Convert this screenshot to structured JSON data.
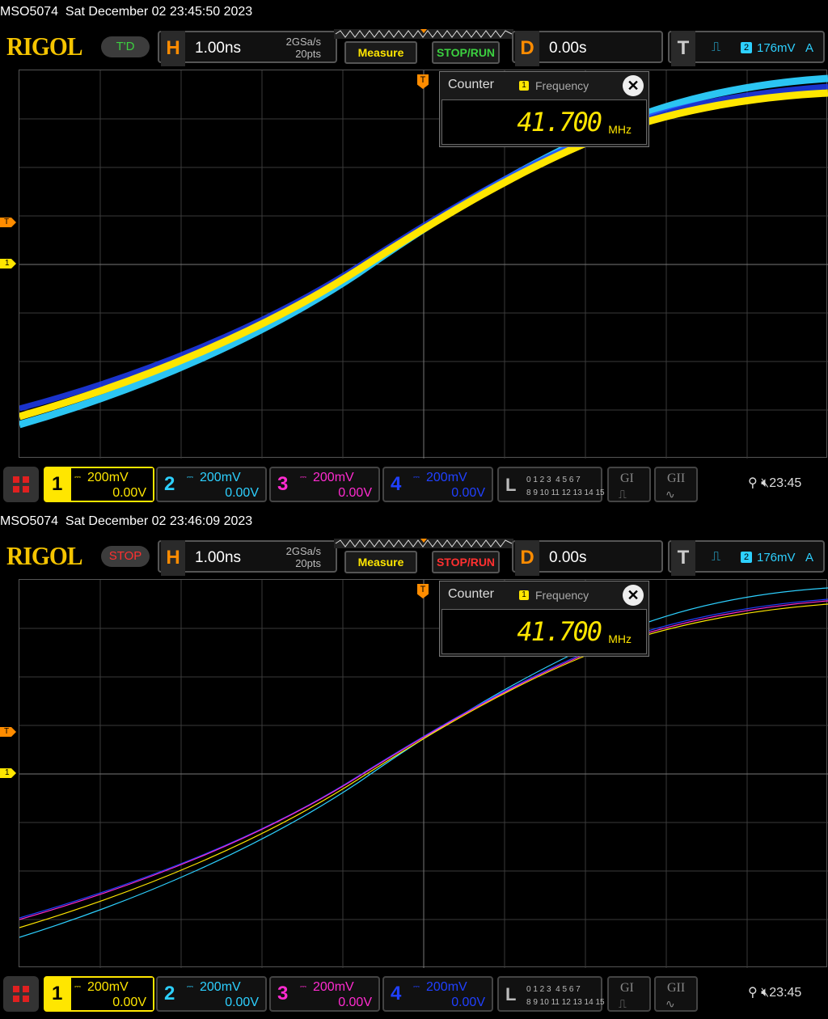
{
  "screens": [
    {
      "caption": "MSO5074  Sat December 02 23:45:50 2023",
      "logo": "RIGOL",
      "status": "T'D",
      "status_color": "#3cd040",
      "horizontal": {
        "letter": "H",
        "timebase": "1.00ns",
        "sample_rate": "2GSa/s",
        "points": "20pts"
      },
      "measure_label": "Measure",
      "stoprun_label": "STOP/RUN",
      "stoprun_color": "#3cd040",
      "delay": {
        "letter": "D",
        "value": "0.00s"
      },
      "trigger": {
        "letter": "T",
        "edge_icon": "rising-edge-icon",
        "source": "2",
        "level": "176mV",
        "mode": "A"
      },
      "markers": {
        "trigger_level": "T",
        "channel_1": "1"
      },
      "counter": {
        "title": "Counter",
        "channel": "1",
        "measurement": "Frequency",
        "value": "41.700",
        "unit": "MHz",
        "close": "✕"
      },
      "channels": [
        {
          "num": "1",
          "scale": "200mV",
          "offset": "0.00V"
        },
        {
          "num": "2",
          "scale": "200mV",
          "offset": "0.00V"
        },
        {
          "num": "3",
          "scale": "200mV",
          "offset": "0.00V"
        },
        {
          "num": "4",
          "scale": "200mV",
          "offset": "0.00V"
        }
      ],
      "logic": {
        "letter": "L",
        "row1": "0 1 2 3  4 5 6 7",
        "row2": "8 9 10 11 12 13 14 15"
      },
      "generators": [
        "GI",
        "GII"
      ],
      "clock": "23:45"
    },
    {
      "caption": "MSO5074  Sat December 02 23:46:09 2023",
      "logo": "RIGOL",
      "status": "STOP",
      "status_color": "#ff3030",
      "horizontal": {
        "letter": "H",
        "timebase": "1.00ns",
        "sample_rate": "2GSa/s",
        "points": "20pts"
      },
      "measure_label": "Measure",
      "stoprun_label": "STOP/RUN",
      "stoprun_color": "#ff3030",
      "delay": {
        "letter": "D",
        "value": "0.00s"
      },
      "trigger": {
        "letter": "T",
        "edge_icon": "rising-edge-icon",
        "source": "2",
        "level": "176mV",
        "mode": "A"
      },
      "markers": {
        "trigger_level": "T",
        "channel_1": "1"
      },
      "counter": {
        "title": "Counter",
        "channel": "1",
        "measurement": "Frequency",
        "value": "41.700",
        "unit": "MHz",
        "close": "✕"
      },
      "channels": [
        {
          "num": "1",
          "scale": "200mV",
          "offset": "0.00V"
        },
        {
          "num": "2",
          "scale": "200mV",
          "offset": "0.00V"
        },
        {
          "num": "3",
          "scale": "200mV",
          "offset": "0.00V"
        },
        {
          "num": "4",
          "scale": "200mV",
          "offset": "0.00V"
        }
      ],
      "logic": {
        "letter": "L",
        "row1": "0 1 2 3  4 5 6 7",
        "row2": "8 9 10 11 12 13 14 15"
      },
      "generators": [
        "GI",
        "GII"
      ],
      "clock": "23:45"
    }
  ],
  "colors": {
    "ch1": "#ffe600",
    "ch2": "#2dd0ff",
    "ch3": "#ff2bd0",
    "ch4": "#2040ff",
    "trigger": "#ff8c00"
  }
}
